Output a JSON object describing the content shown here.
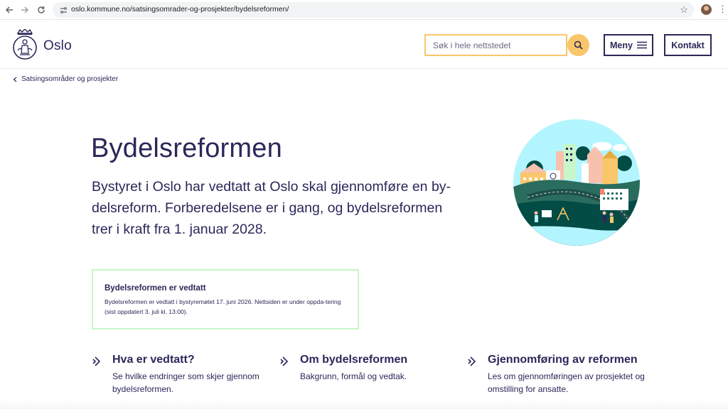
{
  "browser": {
    "url": "oslo.kommune.no/satsingsomrader-og-prosjekter/bydelsreformen/",
    "back_icon": "arrow-left-icon",
    "forward_icon": "arrow-right-icon",
    "reload_icon": "reload-icon",
    "bookmark_icon": "star-icon",
    "menu_icon": "kebab-icon"
  },
  "header": {
    "logo_text": "Oslo",
    "search_placeholder": "Søk i hele nettstedet",
    "menu_label": "Meny",
    "contact_label": "Kontakt",
    "accent_color": "#f9c66b",
    "brand_color": "#2a2859"
  },
  "breadcrumb": {
    "label": "Satsingsområder og prosjekter"
  },
  "hero": {
    "title": "Bydelsreformen",
    "lead": "Bystyret i Oslo har vedtatt at Oslo skal gjennomføre en by-delsreform. Forberedelsene er i gang, og bydelsreformen trer i kraft fra 1. januar 2028."
  },
  "alert": {
    "title": "Bydelsreformen er vedtatt",
    "body": "Bydelsreformen er vedtatt i bystyremøtet 17. juni 2026. Nettsiden er under oppda-tering (sist oppdatert 3. juli kl. 13:00).",
    "border_color": "#c7f6c9"
  },
  "cards": [
    {
      "title": "Hva er vedtatt?",
      "description": "Se hvilke endringer som skjer gjennom bydelsreformen."
    },
    {
      "title": "Om bydelsreformen",
      "description": "Bakgrunn, formål og vedtak."
    },
    {
      "title": "Gjennomføring av reformen",
      "description": "Les om gjennomføringen av prosjektet og omstilling for ansatte."
    }
  ]
}
